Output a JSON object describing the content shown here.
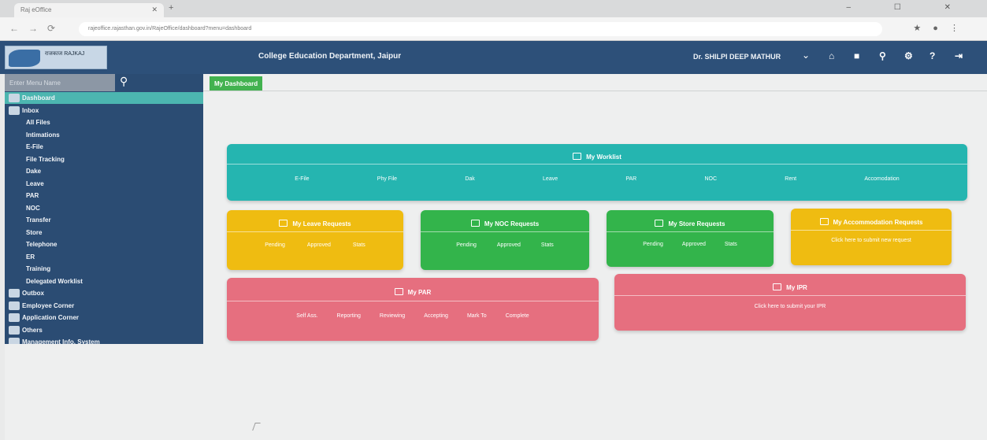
{
  "browser": {
    "tab_title": "Raj eOffice",
    "url": "rajeoffice.rajasthan.gov.in/RajeOffice/dashboard?menu=dashboard",
    "back": "←",
    "forward": "→",
    "reload": "⟳",
    "window_controls": "– ☐ ✕",
    "extensions": "★ ● ⋮"
  },
  "header": {
    "logo_text": "राजकाज RAJKAJ",
    "title": "College Education Department, Jaipur",
    "user": "Dr. SHILPI DEEP MATHUR",
    "caret": "⌄",
    "icons": [
      "home-icon",
      "grid-icon",
      "search-icon",
      "gear-icon",
      "help-icon",
      "logout-icon"
    ],
    "icon_glyphs": [
      "⌂",
      "■",
      "⚲",
      "⚙",
      "?",
      "⇥"
    ]
  },
  "sidebar": {
    "search_placeholder": "Enter Menu Name",
    "search_glyph": "⚲",
    "items": [
      {
        "label": "Dashboard",
        "active": true,
        "icon": true
      },
      {
        "label": "Inbox",
        "icon": true
      },
      {
        "label": "All Files",
        "sub": true
      },
      {
        "label": "Intimations",
        "sub": true
      },
      {
        "label": "E-File",
        "sub": true
      },
      {
        "label": "File Tracking",
        "sub": true
      },
      {
        "label": "Dake",
        "sub": true
      },
      {
        "label": "Leave",
        "sub": true
      },
      {
        "label": "PAR",
        "sub": true
      },
      {
        "label": "NOC",
        "sub": true
      },
      {
        "label": "Transfer",
        "sub": true
      },
      {
        "label": "Store",
        "sub": true
      },
      {
        "label": "Telephone",
        "sub": true
      },
      {
        "label": "ER",
        "sub": true
      },
      {
        "label": "Training",
        "sub": true
      },
      {
        "label": "Delegated Worklist",
        "sub": true
      },
      {
        "label": "Outbox",
        "icon": true
      },
      {
        "label": "Employee Corner",
        "icon": true
      },
      {
        "label": "Application Corner",
        "icon": true
      },
      {
        "label": "Others",
        "icon": true
      },
      {
        "label": "Management Info. System",
        "icon": true
      }
    ]
  },
  "main": {
    "tab_label": "My Dashboard",
    "worklist": {
      "title": "My Worklist",
      "links": [
        "E-File",
        "Phy File",
        "Dak",
        "Leave",
        "PAR",
        "NOC",
        "Rent",
        "Accomodation"
      ]
    },
    "leave": {
      "title": "My Leave Requests",
      "links": [
        "Pending",
        "Approved",
        "Stats"
      ]
    },
    "noc": {
      "title": "My NOC Requests",
      "links": [
        "Pending",
        "Approved",
        "Stats"
      ]
    },
    "store": {
      "title": "My Store Requests",
      "links": [
        "Pending",
        "Approved",
        "Stats"
      ]
    },
    "accommodation": {
      "title": "My Accommodation Requests",
      "text": "Click here to submit new request"
    },
    "par": {
      "title": "My PAR",
      "links": [
        "Self Ass.",
        "Reporting",
        "Reviewing",
        "Accepting",
        "Mark To",
        "Complete"
      ]
    },
    "ipr": {
      "title": "My IPR",
      "text": "Click here to submit your IPR"
    }
  }
}
